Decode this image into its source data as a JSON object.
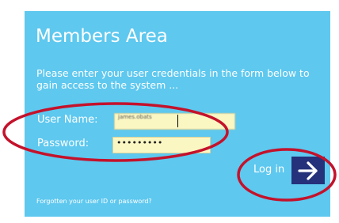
{
  "panel": {
    "title": "Members Area",
    "intro": "Please enter your user credentials in the form below to gain access to the system ...",
    "color": "#5ec8ef"
  },
  "form": {
    "username_label": "User Name:",
    "username_value": "james.obats",
    "password_label": "Password:",
    "password_value": "•••••••••",
    "input_bg": "#fbf7c3"
  },
  "login": {
    "label": "Log in",
    "icon": "arrow-right-icon",
    "button_color": "#25317a"
  },
  "links": {
    "forgot": "Forgotten your user ID or password?"
  },
  "annotation_color": "#c4122b"
}
